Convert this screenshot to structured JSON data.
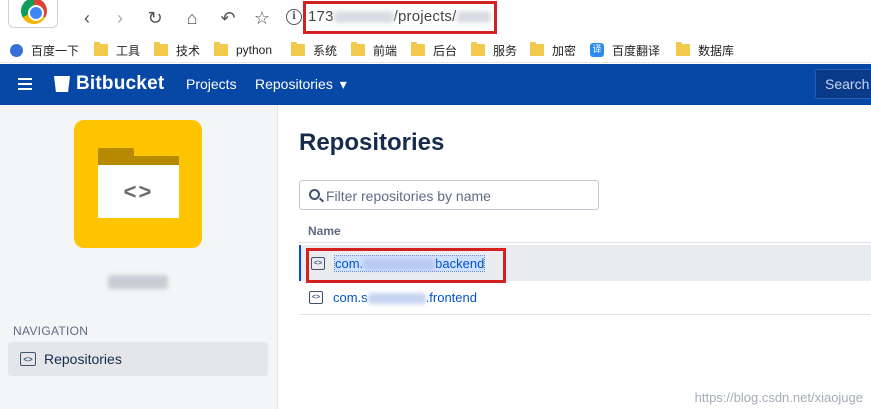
{
  "browser": {
    "url_prefix": "173",
    "url_path": "/projects/",
    "info_glyph": "i",
    "bookmarks": [
      {
        "label": "百度一下",
        "icon": "baidu-icon"
      },
      {
        "label": "工具",
        "icon": "folder-icon"
      },
      {
        "label": "技术",
        "icon": "folder-icon"
      },
      {
        "label": "python",
        "icon": "folder-icon"
      },
      {
        "label": "系统",
        "icon": "folder-icon"
      },
      {
        "label": "前端",
        "icon": "folder-icon"
      },
      {
        "label": "后台",
        "icon": "folder-icon"
      },
      {
        "label": "服务",
        "icon": "folder-icon"
      },
      {
        "label": "加密",
        "icon": "folder-icon"
      },
      {
        "label": "百度翻译",
        "icon": "fanyi-icon"
      },
      {
        "label": "数据库",
        "icon": "folder-icon"
      }
    ],
    "fanyi_glyph": "译"
  },
  "header": {
    "brand": "Bitbucket",
    "nav": [
      "Projects",
      "Repositories"
    ],
    "dropdown_glyph": "▾",
    "search_placeholder": "Search"
  },
  "sidebar": {
    "avatar_glyph": "<>",
    "nav_heading": "NAVIGATION",
    "nav_items": [
      {
        "label": "Repositories"
      }
    ]
  },
  "main": {
    "title": "Repositories",
    "filter_placeholder": "Filter repositories by name",
    "column_header": "Name",
    "repos": [
      {
        "prefix": "com.",
        "suffix": "backend",
        "selected": true
      },
      {
        "prefix": "com.s",
        "suffix": ".frontend",
        "selected": false
      }
    ]
  },
  "watermark": "https://blog.csdn.net/xiaojuge",
  "colors": {
    "header_bg": "#0747a6",
    "avatar_bg": "#ffc400",
    "link": "#0052cc",
    "annotation_red": "#d42020"
  }
}
